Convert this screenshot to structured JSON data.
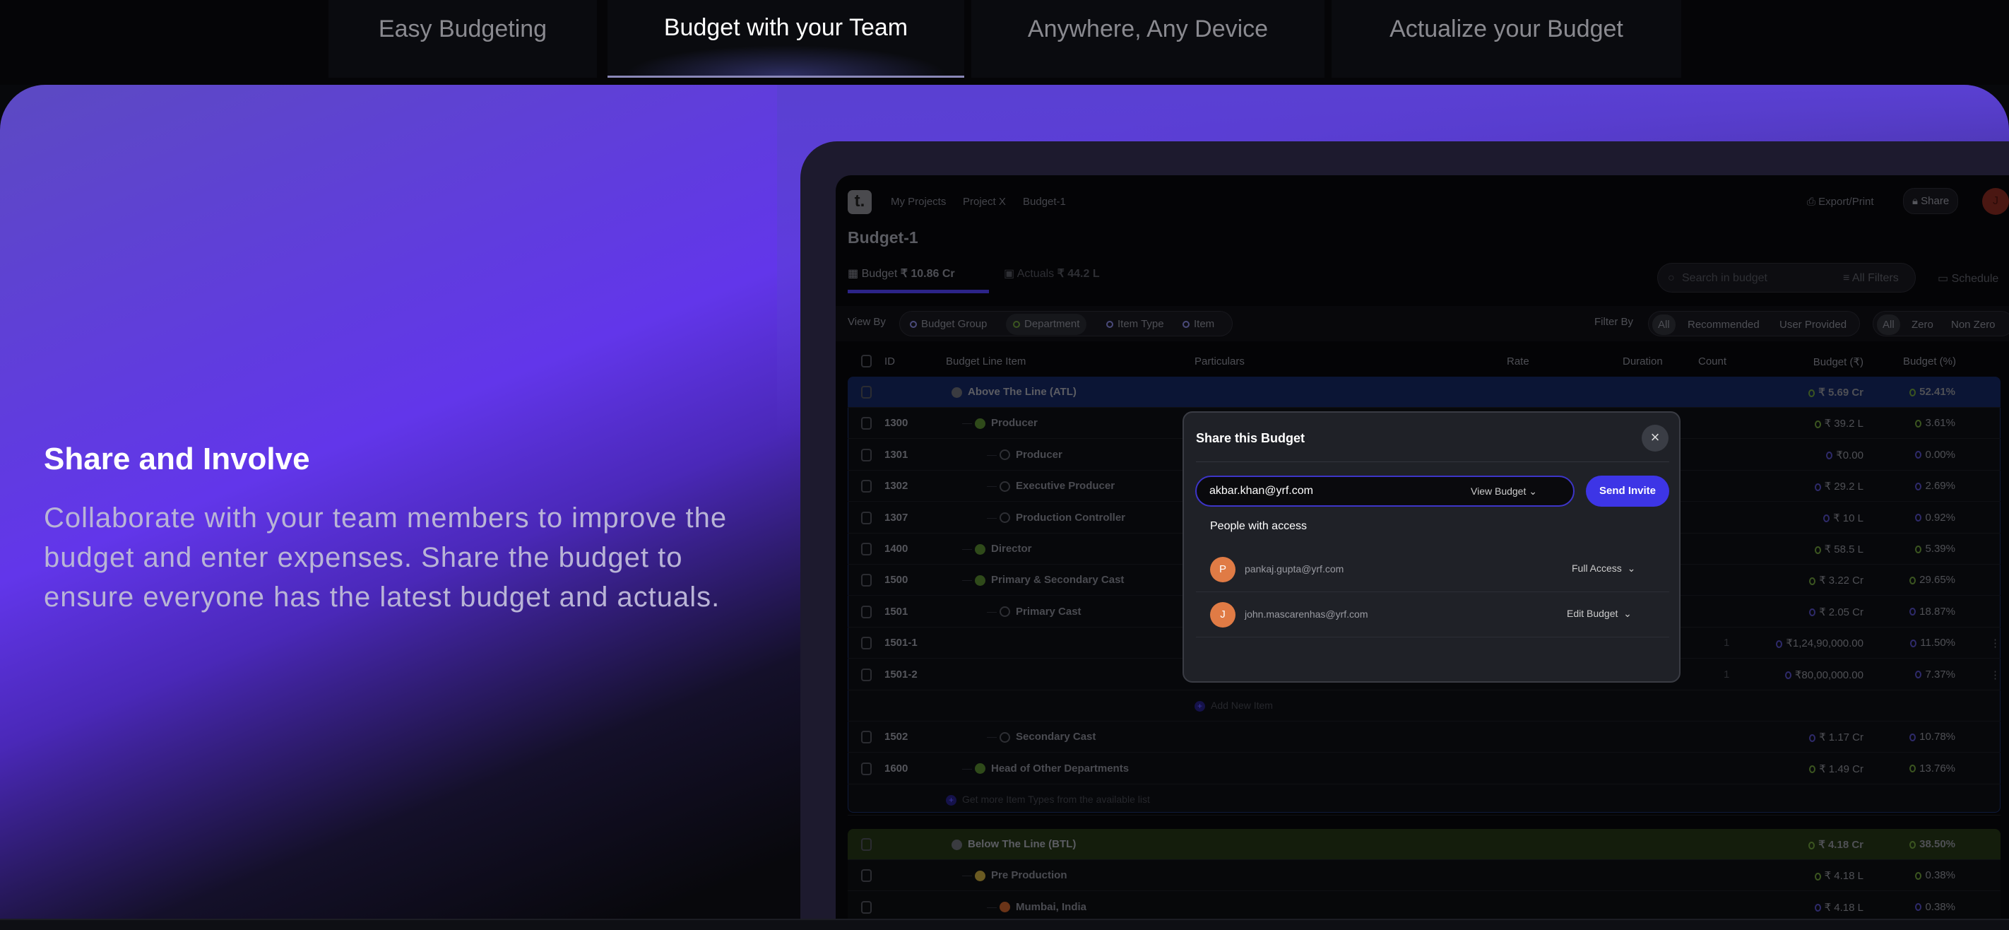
{
  "feature_tabs": [
    {
      "label": "Easy Budgeting"
    },
    {
      "label": "Budget with your Team",
      "active": true
    },
    {
      "label": "Anywhere, Any Device"
    },
    {
      "label": "Actualize your Budget"
    }
  ],
  "hero": {
    "title": "Share and Involve",
    "description": "Collaborate with your team members to improve the budget and enter expenses. Share the budget to ensure everyone has the latest budget and actuals."
  },
  "app": {
    "logo": "t.",
    "breadcrumb": [
      "My Projects",
      "Project X",
      "Budget-1"
    ],
    "export_label": "Export/Print",
    "share_label": "Share",
    "avatar": "J",
    "title": "Budget-1",
    "tabs": {
      "budget_label": "Budget",
      "budget_value": "₹ 10.86 Cr",
      "actuals_label": "Actuals",
      "actuals_value": "₹ 44.2 L"
    },
    "search_placeholder": "Search in budget",
    "filters_label": "All Filters",
    "schedule_label": "Schedule",
    "view_by": {
      "label": "View By",
      "options": [
        "Budget Group",
        "Department",
        "Item Type",
        "Item"
      ],
      "active": "Department"
    },
    "filter_by": {
      "label": "Filter By",
      "options": [
        "All",
        "Recommended",
        "User Provided"
      ],
      "zero_options": [
        "All",
        "Zero",
        "Non Zero"
      ]
    },
    "columns": [
      "ID",
      "Budget Line Item",
      "Particulars",
      "Rate",
      "Duration",
      "Count",
      "Budget (₹)",
      "Budget (%)"
    ],
    "rows": [
      {
        "kind": "group",
        "name": "Above The Line (ATL)",
        "budget": "₹ 5.69 Cr",
        "pct": "52.41%",
        "color": "#0b1535"
      },
      {
        "kind": "item",
        "id": "1300",
        "name": "Producer",
        "level": 1,
        "budget": "₹ 39.2 L",
        "pct": "3.61%"
      },
      {
        "kind": "item",
        "id": "1301",
        "name": "Producer",
        "level": 2,
        "budget": "₹0.00",
        "pct": "0.00%"
      },
      {
        "kind": "item",
        "id": "1302",
        "name": "Executive Producer",
        "level": 2,
        "budget": "₹ 29.2 L",
        "pct": "2.69%"
      },
      {
        "kind": "item",
        "id": "1307",
        "name": "Production Controller",
        "level": 2,
        "budget": "₹ 10 L",
        "pct": "0.92%"
      },
      {
        "kind": "item",
        "id": "1400",
        "name": "Director",
        "level": 1,
        "budget": "₹ 58.5 L",
        "pct": "5.39%"
      },
      {
        "kind": "item",
        "id": "1500",
        "name": "Primary & Secondary Cast",
        "level": 1,
        "budget": "₹ 3.22 Cr",
        "pct": "29.65%"
      },
      {
        "kind": "item",
        "id": "1501",
        "name": "Primary Cast",
        "level": 2,
        "budget": "₹ 2.05 Cr",
        "pct": "18.87%"
      },
      {
        "kind": "item",
        "id": "1501-1",
        "name": "",
        "level": 3,
        "count": "1",
        "budget": "₹1,24,90,000.00",
        "pct": "11.50%",
        "menu": true
      },
      {
        "kind": "item",
        "id": "1501-2",
        "name": "",
        "level": 3,
        "count": "1",
        "budget": "₹80,00,000.00",
        "pct": "7.37%",
        "menu": true
      },
      {
        "kind": "add",
        "name": "Add New Item"
      },
      {
        "kind": "item",
        "id": "1502",
        "name": "Secondary Cast",
        "level": 2,
        "budget": "₹ 1.17 Cr",
        "pct": "10.78%"
      },
      {
        "kind": "item",
        "id": "1600",
        "name": "Head of Other Departments",
        "level": 1,
        "budget": "₹ 1.49 Cr",
        "pct": "13.76%"
      },
      {
        "kind": "more",
        "name": "Get more Item Types from the available list"
      },
      {
        "kind": "group",
        "name": "Below The Line (BTL)",
        "budget": "₹ 4.18 Cr",
        "pct": "38.50%",
        "color": "#141d0c"
      },
      {
        "kind": "item",
        "id": "",
        "name": "Pre Production",
        "level": 1,
        "budget": "₹ 4.18 L",
        "pct": "0.38%",
        "dot": "#6a5a22"
      },
      {
        "kind": "item",
        "id": "",
        "name": "Mumbai, India",
        "level": 2,
        "budget": "₹ 4.18 L",
        "pct": "0.38%",
        "dot": "#6a3418"
      }
    ]
  },
  "modal": {
    "title": "Share this Budget",
    "close": "×",
    "email_value": "akbar.khan@yrf.com",
    "permission": "View Budget",
    "send_label": "Send Invite",
    "people_label": "People with access",
    "people": [
      {
        "initial": "P",
        "email": "pankaj.gupta@yrf.com",
        "access": "Full Access"
      },
      {
        "initial": "J",
        "email": "john.mascarenhas@yrf.com",
        "access": "Edit Budget"
      }
    ]
  },
  "colors": {
    "accent": "#3d35e6",
    "avatar": "#e07b45"
  }
}
